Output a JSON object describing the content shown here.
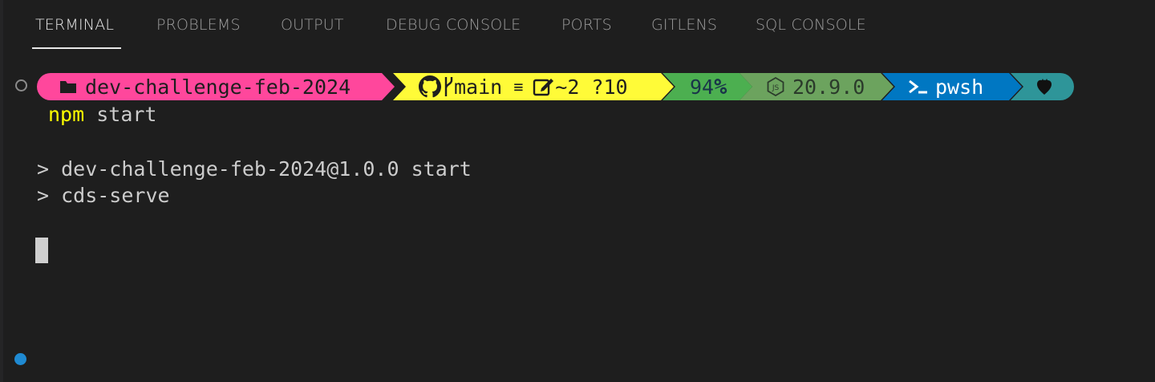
{
  "tabs": [
    {
      "label": "TERMINAL",
      "active": true
    },
    {
      "label": "PROBLEMS"
    },
    {
      "label": "OUTPUT"
    },
    {
      "label": "DEBUG CONSOLE"
    },
    {
      "label": "PORTS"
    },
    {
      "label": "GITLENS"
    },
    {
      "label": "SQL CONSOLE"
    }
  ],
  "prompt": {
    "path": "dev-challenge-feb-2024",
    "branch": "main",
    "branch_status": "≡",
    "working": "~2 ?10",
    "battery": "94",
    "battery_unit": "%",
    "node_version": "20.9.0",
    "shell_prefix": "≻_",
    "shell": "pwsh",
    "icons": {
      "path": "folder-icon",
      "git": "github-icon",
      "branch": "git-branch-icon",
      "edit": "edit-icon",
      "node": "nodejs-icon",
      "shell": "terminal-icon",
      "end": "heart-icon"
    },
    "colors": {
      "path": "#ff479c",
      "git": "#fffb38",
      "battery": "#4caf50",
      "node": "#6ca35e",
      "shell": "#0077c2",
      "end": "#2e9599"
    }
  },
  "command": {
    "bin": "npm",
    "args": "start"
  },
  "output": [
    "> dev-challenge-feb-2024@1.0.0 start",
    "> cds-serve"
  ]
}
